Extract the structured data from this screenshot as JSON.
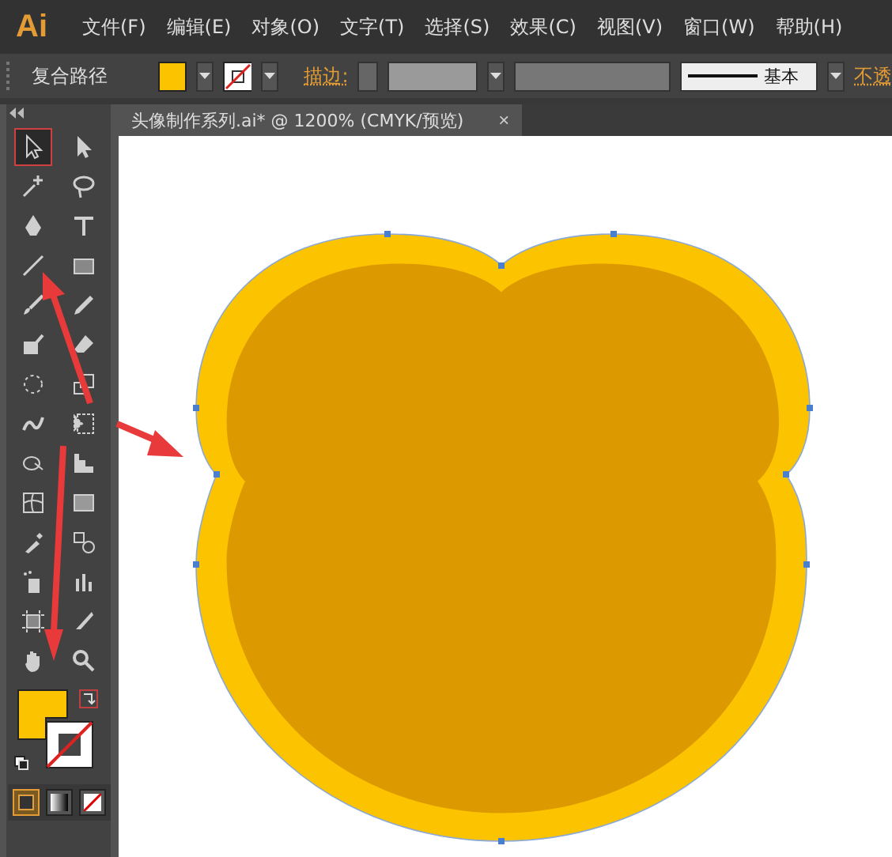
{
  "app": {
    "logo": "Ai"
  },
  "menu": [
    "文件(F)",
    "编辑(E)",
    "对象(O)",
    "文字(T)",
    "选择(S)",
    "效果(C)",
    "视图(V)",
    "窗口(W)",
    "帮助(H)"
  ],
  "control_bar": {
    "object_type": "复合路径",
    "stroke_label": "描边:",
    "stroke_style": "基本",
    "opacity_label": "不透"
  },
  "document_tab": {
    "title": "头像制作系列.ai* @ 1200% (CMYK/预览)",
    "close": "×"
  },
  "tools": [
    {
      "kind": "select",
      "selected": true
    },
    {
      "kind": "direct",
      "selected": false
    },
    {
      "kind": "wand",
      "selected": false
    },
    {
      "kind": "lasso",
      "selected": false
    },
    {
      "kind": "pen",
      "selected": false
    },
    {
      "kind": "type",
      "selected": false
    },
    {
      "kind": "line",
      "selected": false
    },
    {
      "kind": "rect",
      "selected": false
    },
    {
      "kind": "brush",
      "selected": false
    },
    {
      "kind": "pencil",
      "selected": false
    },
    {
      "kind": "blob",
      "selected": false
    },
    {
      "kind": "eraser",
      "selected": false
    },
    {
      "kind": "rotate",
      "selected": false
    },
    {
      "kind": "scale",
      "selected": false
    },
    {
      "kind": "warp",
      "selected": false
    },
    {
      "kind": "transform",
      "selected": false
    },
    {
      "kind": "builder",
      "selected": false
    },
    {
      "kind": "perspective",
      "selected": false
    },
    {
      "kind": "mesh",
      "selected": false
    },
    {
      "kind": "gradient",
      "selected": false
    },
    {
      "kind": "eyedropper",
      "selected": false
    },
    {
      "kind": "blend",
      "selected": false
    },
    {
      "kind": "sprayer",
      "selected": false
    },
    {
      "kind": "graph",
      "selected": false
    },
    {
      "kind": "artboard",
      "selected": false
    },
    {
      "kind": "slice",
      "selected": false
    },
    {
      "kind": "hand",
      "selected": false
    },
    {
      "kind": "zoom",
      "selected": false
    }
  ],
  "draw_modes": [
    {
      "kind": "color",
      "selected": true
    },
    {
      "kind": "gradient",
      "selected": false
    },
    {
      "kind": "none",
      "selected": false
    }
  ]
}
